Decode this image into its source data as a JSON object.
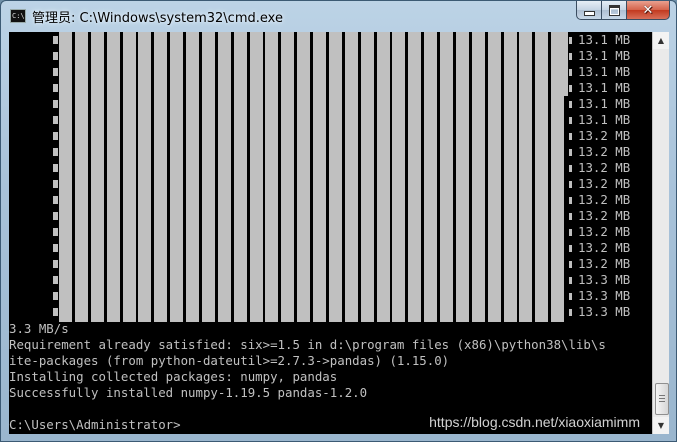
{
  "window": {
    "title": "管理员: C:\\Windows\\system32\\cmd.exe",
    "icon": "cmd-icon",
    "controls": {
      "minimize": "minimize-icon",
      "maximize": "maximize-icon",
      "close": "close-icon",
      "close_glyph": "✕"
    }
  },
  "console": {
    "progress_bar_percent": 100,
    "download_sizes": [
      "13.1 MB",
      "13.1 MB",
      "13.1 MB",
      "13.1 MB",
      "13.1 MB",
      "13.1 MB",
      "13.2 MB",
      "13.2 MB",
      "13.2 MB",
      "13.2 MB",
      "13.2 MB",
      "13.2 MB",
      "13.2 MB",
      "13.2 MB",
      "13.2 MB",
      "13.3 MB",
      "13.3 MB",
      "13.3 MB"
    ],
    "lines": [
      "3.3 MB/s",
      "Requirement already satisfied: six>=1.5 in d:\\program files (x86)\\python38\\lib\\s",
      "ite-packages (from python-dateutil>=2.7.3->pandas) (1.15.0)",
      "Installing collected packages: numpy, pandas",
      "Successfully installed numpy-1.19.5 pandas-1.2.0",
      "",
      "C:\\Users\\Administrator>"
    ],
    "watermark": "https://blog.csdn.net/xiaoxiamimm"
  },
  "colors": {
    "console_bg": "#000000",
    "console_fg": "#c0c0c0",
    "title_bar": "#bcd3e6",
    "close_button": "#c2391f"
  }
}
